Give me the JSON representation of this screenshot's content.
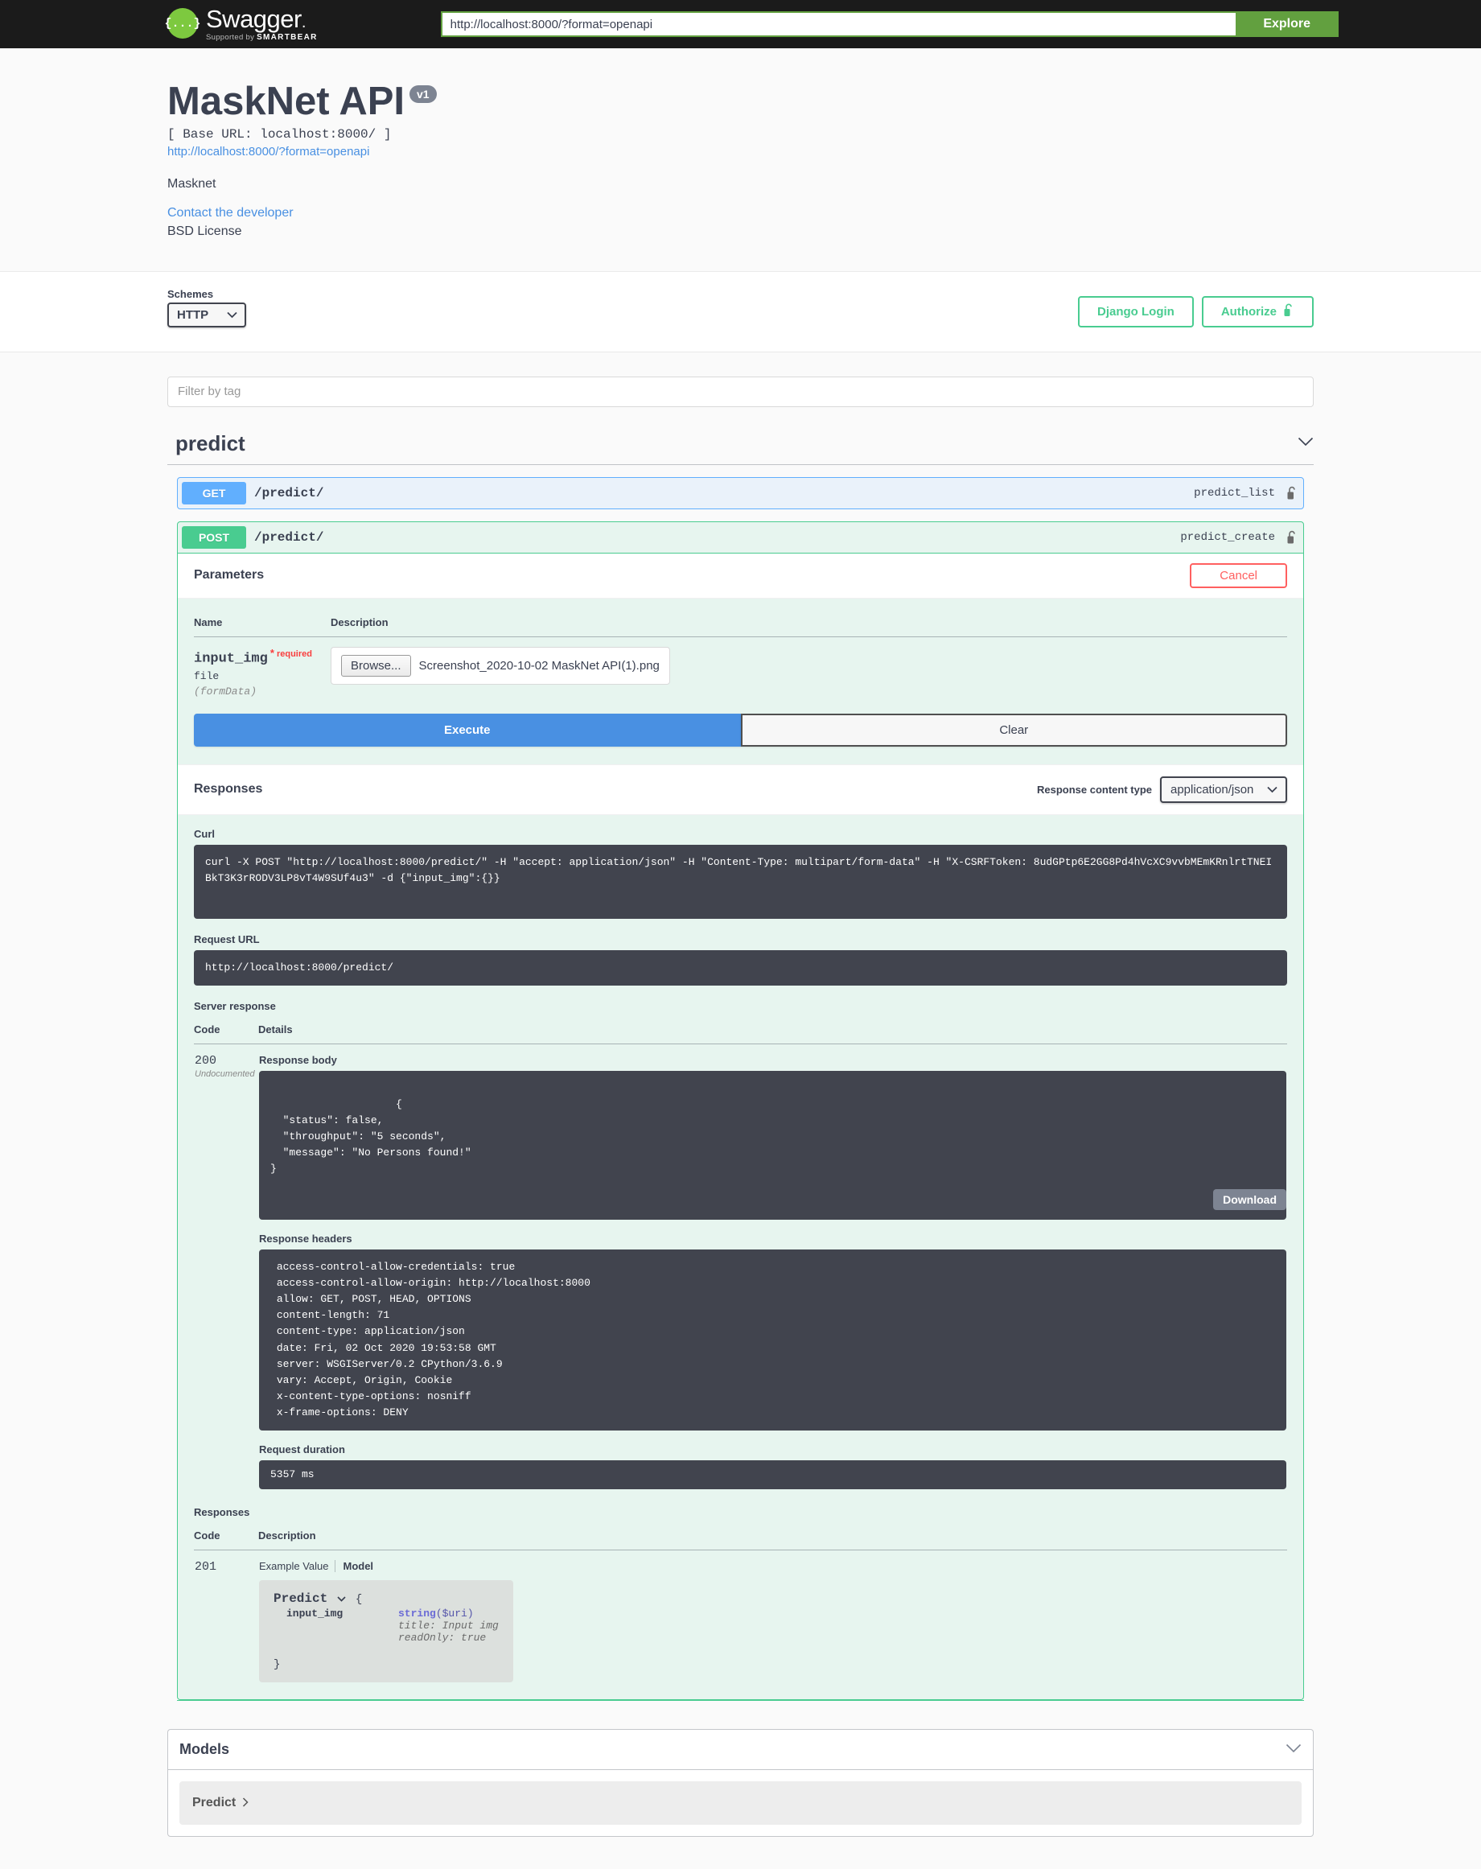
{
  "topbar": {
    "logo_text": "Swagger",
    "logo_sub_prefix": "Supported by ",
    "logo_sub_brand": "SMARTBEAR",
    "logo_glyph": "{...}",
    "url_value": "http://localhost:8000/?format=openapi",
    "url_placeholder": "http://localhost:8000/?format=openapi",
    "explore_label": "Explore"
  },
  "info": {
    "title": "MaskNet API",
    "version_badge": "v1",
    "base_url": "[ Base URL: localhost:8000/ ]",
    "spec_link": "http://localhost:8000/?format=openapi",
    "description": "Masknet",
    "contact_link": "Contact the developer",
    "license": "BSD License"
  },
  "schemes": {
    "label": "Schemes",
    "selected": "HTTP",
    "options": [
      "HTTP"
    ],
    "caret_icon": "chevron-down-icon"
  },
  "auth": {
    "django_login_label": "Django Login",
    "authorize_label": "Authorize",
    "lock_icon": "unlocked-padlock-icon"
  },
  "filter": {
    "placeholder": "Filter by tag",
    "value": ""
  },
  "tag": {
    "name": "predict",
    "chevron_icon": "chevron-down-icon"
  },
  "operations": [
    {
      "method": "GET",
      "path": "/predict/",
      "operation_id": "predict_list",
      "lock_icon": "unlocked-padlock-icon",
      "color": "#61affe"
    },
    {
      "method": "POST",
      "path": "/predict/",
      "operation_id": "predict_create",
      "lock_icon": "unlocked-padlock-icon",
      "color": "#49cc90"
    }
  ],
  "parameters_section": {
    "title": "Parameters",
    "cancel_label": "Cancel",
    "col_name": "Name",
    "col_description": "Description",
    "rows": [
      {
        "name": "input_img",
        "required_star": "*",
        "required_label": "required",
        "type": "file",
        "in": "(formData)",
        "browse_label": "Browse...",
        "file_name": "Screenshot_2020-10-02 MaskNet API(1).png"
      }
    ]
  },
  "actions": {
    "execute_label": "Execute",
    "clear_label": "Clear"
  },
  "responses_section": {
    "title": "Responses",
    "content_type_label": "Response content type",
    "content_type_selected": "application/json",
    "content_type_options": [
      "application/json"
    ],
    "caret_icon": "chevron-down-icon"
  },
  "curl": {
    "label": "Curl",
    "command": "curl -X POST \"http://localhost:8000/predict/\" -H \"accept: application/json\" -H \"Content-Type: multipart/form-data\" -H \"X-CSRFToken: 8udGPtp6E2GG8Pd4hVcXC9vvbMEmKRnlrtTNEIBkT3K3rRODV3LP8vT4W9SUf4u3\" -d {\"input_img\":{}}"
  },
  "request_url": {
    "label": "Request URL",
    "value": "http://localhost:8000/predict/"
  },
  "server_response": {
    "label": "Server response",
    "col_code": "Code",
    "col_details": "Details",
    "code": "200",
    "code_note": "Undocumented",
    "response_body_label": "Response body",
    "response_body": "{\n  \"status\": false,\n  \"throughput\": \"5 seconds\",\n  \"message\": \"No Persons found!\"\n}",
    "download_label": "Download",
    "response_headers_label": "Response headers",
    "response_headers": " access-control-allow-credentials: true \n access-control-allow-origin: http://localhost:8000 \n allow: GET, POST, HEAD, OPTIONS \n content-length: 71 \n content-type: application/json \n date: Fri, 02 Oct 2020 19:53:58 GMT \n server: WSGIServer/0.2 CPython/3.6.9 \n vary: Accept, Origin, Cookie \n x-content-type-options: nosniff \n x-frame-options: DENY ",
    "request_duration_label": "Request duration",
    "request_duration": "5357 ms"
  },
  "documented_responses": {
    "title": "Responses",
    "col_code": "Code",
    "col_description": "Description",
    "code": "201",
    "tab_example": "Example Value",
    "tab_model": "Model",
    "model": {
      "name": "Predict",
      "caret_icon": "chevron-down-icon",
      "open_brace": "{",
      "close_brace": "}",
      "properties": [
        {
          "name": "input_img",
          "type_prefix": "string",
          "type_suffix": "($uri)",
          "meta": [
            "title: Input img",
            "readOnly: true"
          ]
        }
      ]
    }
  },
  "models_section": {
    "title": "Models",
    "chevron_icon": "chevron-down-icon",
    "items": [
      {
        "name": "Predict",
        "arrow_icon": "chevron-right-icon"
      }
    ]
  }
}
